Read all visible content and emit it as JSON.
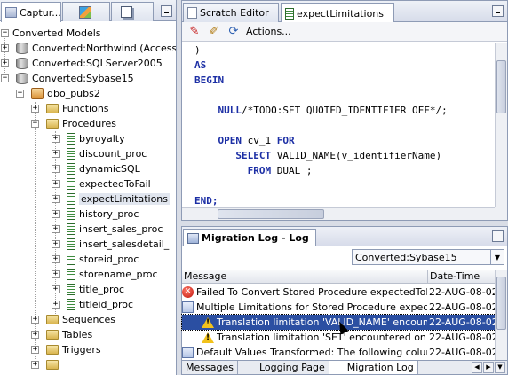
{
  "left_panel": {
    "tabs": [
      {
        "label": "Captur..."
      },
      {
        "label": ""
      },
      {
        "label": ""
      }
    ],
    "tree": {
      "root": "Converted Models",
      "models": [
        "Converted:Northwind (Access",
        "Converted:SQLServer2005",
        "Converted:Sybase15"
      ],
      "schema": "dbo_pubs2",
      "folders": [
        "Functions",
        "Procedures",
        "Sequences",
        "Tables",
        "Triggers"
      ],
      "procedures": [
        "byroyalty",
        "discount_proc",
        "dynamicSQL",
        "expectedToFail",
        "expectLimitations",
        "history_proc",
        "insert_sales_proc",
        "insert_salesdetail_",
        "storeid_proc",
        "storename_proc",
        "title_proc",
        "titleid_proc"
      ],
      "selected_procedure": "expectLimitations"
    }
  },
  "editor": {
    "tabs": [
      "Scratch Editor",
      "expectLimitations"
    ],
    "toolbar": {
      "actions_label": "Actions..."
    },
    "code_lines": [
      {
        "text": ")",
        "kind": "plain"
      },
      {
        "text": "AS",
        "kind": "kw"
      },
      {
        "text": "BEGIN",
        "kind": "kw"
      },
      {
        "text": "",
        "kind": "plain"
      },
      {
        "text": "    NULL/*TODO:SET QUOTED_IDENTIFIER OFF*/;",
        "kind": "mixed"
      },
      {
        "text": "",
        "kind": "plain"
      },
      {
        "text": "    OPEN cv_1 FOR",
        "kind": "mixed"
      },
      {
        "text": "       SELECT VALID_NAME(v_identifierName)",
        "kind": "mixed"
      },
      {
        "text": "         FROM DUAL ;",
        "kind": "mixed"
      },
      {
        "text": "",
        "kind": "plain"
      },
      {
        "text": "END;",
        "kind": "kw"
      }
    ]
  },
  "migration_log": {
    "title": "Migration Log - Log",
    "filter": "Converted:Sybase15",
    "columns": [
      "Message",
      "Date-Time"
    ],
    "rows": [
      {
        "icon": "error-icon",
        "message": "Failed To Convert Stored Procedure expectedToFail",
        "datetime": "22-AUG-08-02:"
      },
      {
        "icon": "multi-icon",
        "message": "Multiple Limitations for Stored Procedure expectLimitat",
        "datetime": "22-AUG-08-02:"
      },
      {
        "icon": "warning-icon",
        "message": "Translation limitation 'VALID_NAME' encountered",
        "datetime": "22-AUG-08-02:"
      },
      {
        "icon": "warning-icon",
        "message": "Translation limitation 'SET' encountered on Stored",
        "datetime": "22-AUG-08-02:"
      },
      {
        "icon": "multi-icon",
        "message": "Default Values Transformed: The following column de",
        "datetime": "22-AUG-08-02:"
      }
    ],
    "bottom_tabs": [
      "Messages",
      "Logging Page",
      "Migration Log"
    ]
  },
  "colors": {
    "keyword": "#1c2fa5",
    "selection": "#2b4fa2",
    "accent_tab_text": "#4f6fb3"
  }
}
